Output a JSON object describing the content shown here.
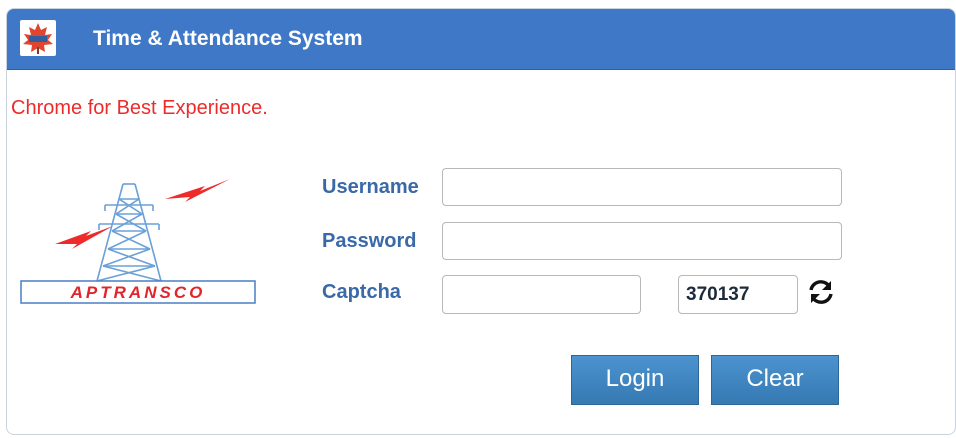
{
  "header": {
    "title": "Time & Attendance System",
    "logo_icon": "maple-leaf-emblem-icon"
  },
  "notice": {
    "text": "Chrome for Best Experience.",
    "color": "#ee2b2b"
  },
  "brand": {
    "logo_text": "APTRANSCO",
    "logo_icon": "transmission-tower-icon"
  },
  "form": {
    "username_label": "Username",
    "username_value": "",
    "password_label": "Password",
    "password_value": "",
    "captcha_label": "Captcha",
    "captcha_value": "",
    "captcha_code": "370137",
    "refresh_icon": "refresh-icon"
  },
  "buttons": {
    "login_label": "Login",
    "clear_label": "Clear"
  },
  "colors": {
    "header_bg": "#3e78c6",
    "label": "#3a69a8",
    "button_bg": "#3f86c2"
  }
}
